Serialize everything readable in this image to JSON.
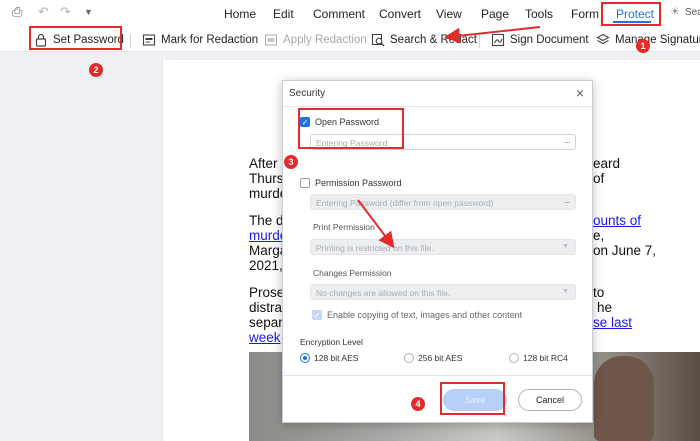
{
  "menu": {
    "home": "Home",
    "edit": "Edit",
    "comment": "Comment",
    "convert": "Convert",
    "view": "View",
    "page": "Page",
    "tools": "Tools",
    "form": "Form",
    "protect": "Protect",
    "search_cut": "Sear"
  },
  "toolbar": {
    "set_password": "Set Password",
    "mark_for_redaction": "Mark for Redaction",
    "apply_redaction": "Apply Redaction",
    "search_redact": "Search & Redact",
    "sign_document": "Sign Document",
    "manage_signatures": "Manage Signatures"
  },
  "document": {
    "lines": [
      {
        "pre": "After",
        "post": "eard"
      },
      {
        "pre": "Thurs",
        "post": "of"
      },
      {
        "pre": "murde",
        "post": ""
      },
      {
        "pre": "The d",
        "link": "ounts of"
      },
      {
        "pre": "murde",
        "post": "e,"
      },
      {
        "pre": "Marga",
        "post": "on June 7,"
      },
      {
        "pre": "2021,",
        "post": ""
      },
      {
        "pre": "Prose",
        "post": "to"
      },
      {
        "pre": "distra",
        "post": "he"
      },
      {
        "pre": "separ",
        "link": "se last"
      },
      {
        "pre": "week",
        "post": ""
      }
    ]
  },
  "dialog": {
    "title": "Security",
    "close": "×",
    "open_password": {
      "label": "Open Password",
      "checked": true,
      "placeholder": "Entering Password"
    },
    "permission_password": {
      "label": "Permission Password",
      "checked": false,
      "placeholder": "Entering Password (differ from open password)"
    },
    "print_permission": {
      "label": "Print Permission",
      "value": "Printing is restricted on this file."
    },
    "changes_permission": {
      "label": "Changes Permission",
      "value": "No changes are allowed on this file."
    },
    "enable_copy": {
      "label": "Enable copying of text, images and other content",
      "checked": true
    },
    "encryption": {
      "label": "Encryption Level",
      "options": [
        {
          "label": "128 bit AES",
          "selected": true
        },
        {
          "label": "256 bit AES",
          "selected": false
        },
        {
          "label": "128 bit RC4",
          "selected": false
        }
      ]
    },
    "save": "Save",
    "cancel": "Cancel"
  },
  "annotations": [
    "1",
    "2",
    "3",
    "4"
  ],
  "colors": {
    "accent": "#1a73e8",
    "annotation": "#e32b2b"
  },
  "icons": [
    "print-icon",
    "undo-icon",
    "redo-icon",
    "dropdown-icon",
    "lock-icon",
    "mark-redaction-icon",
    "apply-redaction-icon",
    "search-redact-icon",
    "sign-icon",
    "manage-signatures-icon",
    "lightbulb-icon",
    "eye-off-icon",
    "chevron-down-icon"
  ]
}
